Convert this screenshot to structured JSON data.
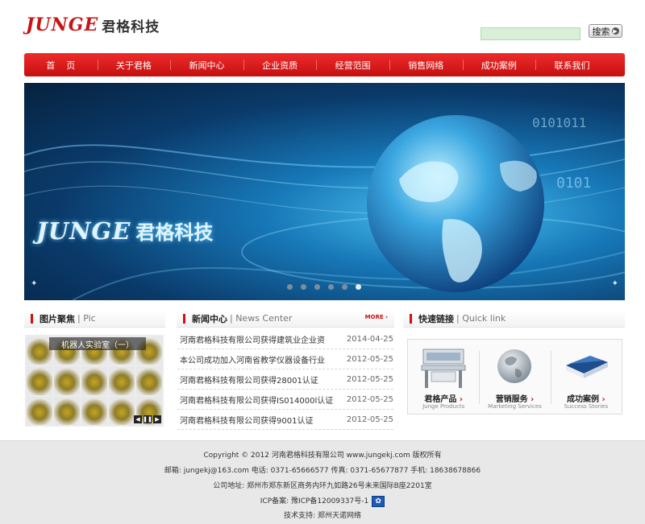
{
  "header": {
    "logo_en": "JUNGE",
    "logo_cn": "君格科技",
    "search_value": "",
    "search_button": "搜索"
  },
  "nav": {
    "items": [
      "首页",
      "关于君格",
      "新闻中心",
      "企业资质",
      "经营范围",
      "销售网络",
      "成功案例",
      "联系我们"
    ]
  },
  "banner": {
    "logo_en": "JUNGE",
    "logo_cn": "君格科技",
    "slide_count": 6,
    "active_slide": 6
  },
  "pics": {
    "title": "图片聚焦",
    "title_en": "Pic",
    "caption": "机器人实验室（一）"
  },
  "news": {
    "title": "新闻中心",
    "title_en": "News Center",
    "more_label": "MORE",
    "items": [
      {
        "title": "河南君格科技有限公司获得建筑业企业资",
        "date": "2014-04-25"
      },
      {
        "title": "本公司成功加入河南省教学仪器设备行业",
        "date": "2012-05-25"
      },
      {
        "title": "河南君格科技有限公司获得28001认证",
        "date": "2012-05-25"
      },
      {
        "title": "河南君格科技有限公司获得IS014000l认证",
        "date": "2012-05-25"
      },
      {
        "title": "河南君格科技有限公司获得9001认证",
        "date": "2012-05-25"
      }
    ]
  },
  "quick": {
    "title": "快速链接",
    "title_en": "Quick link",
    "items": [
      {
        "label": "君格产品",
        "sub": "Junge Products",
        "icon": "products-icon"
      },
      {
        "label": "营销服务",
        "sub": "Marketing Services",
        "icon": "globe-icon"
      },
      {
        "label": "成功案例",
        "sub": "Success Stories",
        "icon": "book-icon"
      }
    ]
  },
  "footer": {
    "copyright": "Copyright © 2012 河南君格科技有限公司 www.jungekj.com 版权所有",
    "contact": "邮箱: jungekj@163.com 电话: 0371-65666577 传真: 0371-65677877 手机: 18638678866",
    "address": "公司地址: 郑州市郑东新区商务内环九如路26号未来国际B座2201室",
    "icp": "ICP备案: 豫ICP备12009337号-1",
    "support": "技术支持: 郑州天诺网络"
  },
  "colors": {
    "brand_red": "#c81414",
    "nav_red": "#d91818",
    "banner_blue": "#1778b8"
  }
}
